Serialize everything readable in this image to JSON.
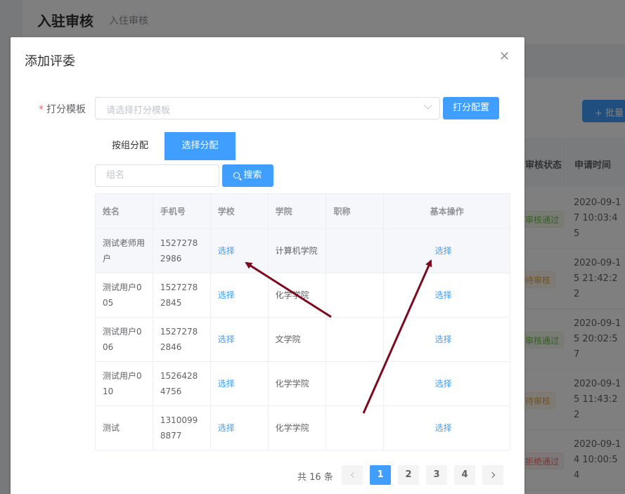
{
  "background": {
    "page_title": "入驻审核",
    "page_subtitle": "入住审核",
    "batch_button": "+ 批量",
    "columns": {
      "status": "审核状态",
      "time": "申请时间"
    },
    "rows": [
      {
        "status": "审核通过",
        "time": "2020-09-17 10:03:45",
        "tag": "green"
      },
      {
        "status": "待审核",
        "time": "2020-09-15 21:42:22",
        "tag": "orange"
      },
      {
        "status": "审核通过",
        "time": "2020-09-15 20:02:57",
        "tag": "green"
      },
      {
        "status": "待审核",
        "time": "2020-09-15 11:43:22",
        "tag": "orange"
      },
      {
        "status": "拒绝通过",
        "time": "2020-09-14 10:00:54",
        "tag": "red"
      }
    ]
  },
  "dialog": {
    "title": "添加评委",
    "close_icon": "close-icon",
    "form": {
      "required_mark": "*",
      "template_label": "打分模板",
      "template_placeholder": "请选择打分模板",
      "config_button": "打分配置"
    },
    "tabs": [
      {
        "label": "按组分配",
        "active": false
      },
      {
        "label": "选择分配",
        "active": true
      }
    ],
    "search": {
      "placeholder": "组名",
      "value": "",
      "button": "搜索"
    },
    "table": {
      "columns": [
        "姓名",
        "手机号",
        "学校",
        "学院",
        "职称",
        "基本操作"
      ],
      "rows": [
        {
          "name": "测试老师用户",
          "phone": "15272782986",
          "school": "选择",
          "college": "计算机学院",
          "title": "",
          "action": "选择"
        },
        {
          "name": "测试用户005",
          "phone": "15272782845",
          "school": "选择",
          "college": "化学学院",
          "title": "",
          "action": "选择"
        },
        {
          "name": "测试用户006",
          "phone": "15272782846",
          "school": "选择",
          "college": "文学院",
          "title": "",
          "action": "选择"
        },
        {
          "name": "测试用户010",
          "phone": "15264284756",
          "school": "选择",
          "college": "化学学院",
          "title": "",
          "action": "选择"
        },
        {
          "name": "测试",
          "phone": "13100998877",
          "school": "选择",
          "college": "化学学院",
          "title": "",
          "action": "选择"
        }
      ]
    },
    "pagination": {
      "total": "共 16 条",
      "pages": [
        "1",
        "2",
        "3",
        "4"
      ],
      "current": "1"
    }
  },
  "colors": {
    "primary": "#409eff",
    "annotation_arrow": "#7d0a1c",
    "mask": "rgba(0,0,0,0.5)"
  }
}
